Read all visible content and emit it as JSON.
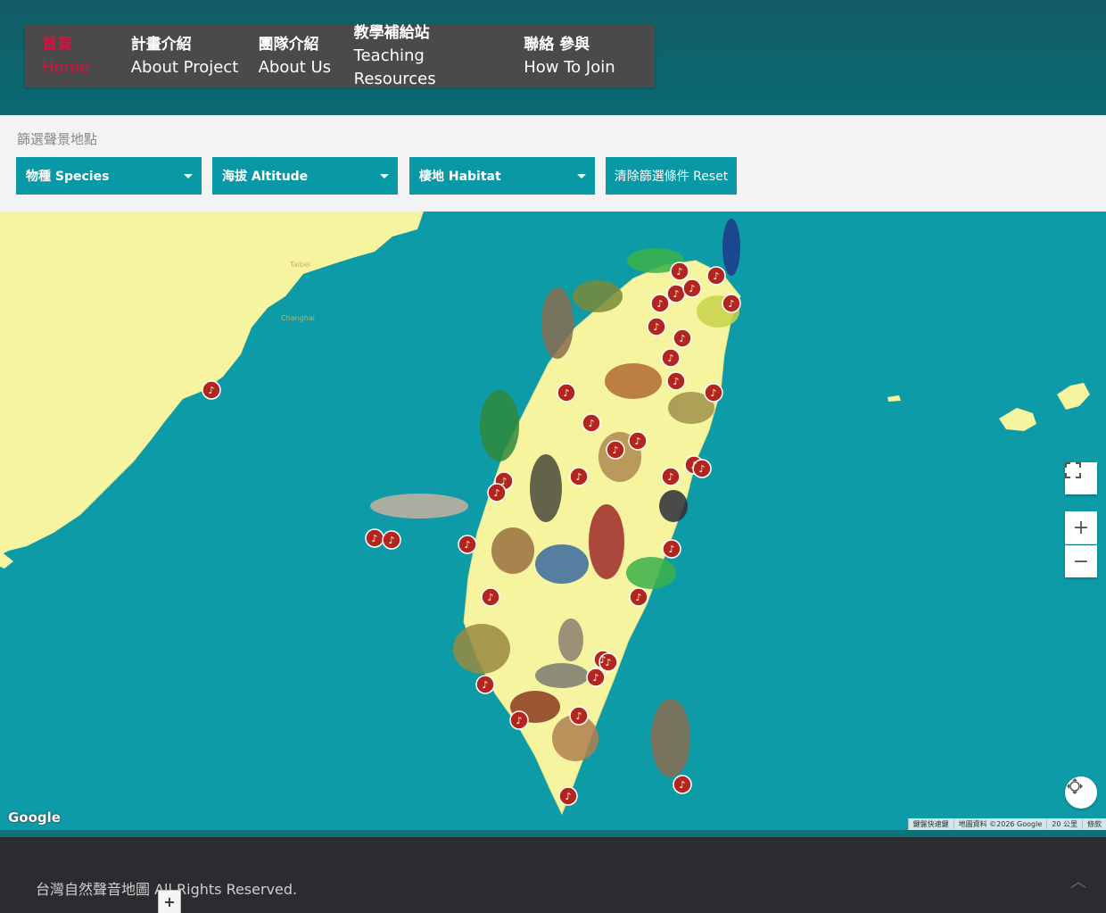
{
  "nav": {
    "items": [
      {
        "zh": "首頁",
        "en": "Home",
        "active": true
      },
      {
        "zh": "計畫介紹",
        "en": "About Project"
      },
      {
        "zh": "團隊介紹",
        "en": "About Us"
      },
      {
        "zh": "教學補給站",
        "en": "Teaching Resources"
      },
      {
        "zh": "聯絡 參與",
        "en": "How To Join"
      }
    ]
  },
  "filters": {
    "label": "篩選聲景地點",
    "species": "物種 Species",
    "altitude": "海拔 Altitude",
    "habitat": "棲地 Habitat",
    "reset": "清除篩選條件 Reset"
  },
  "map": {
    "google_logo": "Google",
    "attribution": [
      "鍵盤快速鍵",
      "地圖資料 ©2026 Google",
      "20 公里",
      "條款"
    ],
    "controls": {
      "zoom_in": "+",
      "zoom_out": "−"
    },
    "place_labels": [
      "Taibei",
      "Changhai"
    ],
    "marker_icon": "music-note-icon",
    "colors": {
      "sea": "#0d9ca7",
      "land": "#f7f4a0",
      "marker": "#b3261e"
    }
  },
  "footer": {
    "copyright": "台灣自然聲音地圖 All Rights Reserved.",
    "plus": "+"
  },
  "colors": {
    "header": "#135d66",
    "nav_bg": "#4a4a4a",
    "active": "#d5133f",
    "button": "#0898a6"
  }
}
